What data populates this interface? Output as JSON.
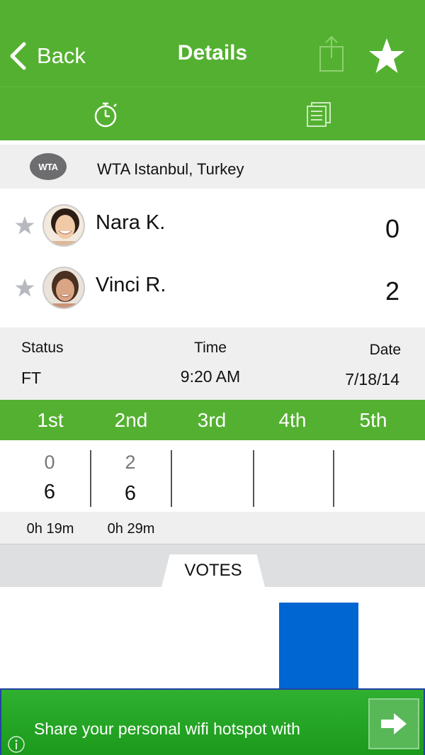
{
  "header": {
    "back_label": "Back",
    "title": "Details",
    "share_icon": "share-icon",
    "favorite_icon": "star-icon"
  },
  "tabs": [
    {
      "icon": "stopwatch-icon"
    },
    {
      "icon": "notes-icon"
    }
  ],
  "tournament": {
    "logo_text": "WTA",
    "name": "WTA Istanbul, Turkey"
  },
  "players": [
    {
      "name": "Nara K.",
      "score": "0"
    },
    {
      "name": "Vinci R.",
      "score": "2"
    }
  ],
  "match_info": {
    "status_label": "Status",
    "status_value": "FT",
    "time_label": "Time",
    "time_value": "9:20 AM",
    "date_label": "Date",
    "date_value": "7/18/14"
  },
  "sets": {
    "labels": [
      "1st",
      "2nd",
      "3rd",
      "4th",
      "5th"
    ],
    "scores": [
      {
        "top": "0",
        "bottom": "6"
      },
      {
        "top": "2",
        "bottom": "6"
      }
    ],
    "durations": [
      "0h 19m",
      "0h 29m"
    ]
  },
  "votes": {
    "tab_label": "VOTES",
    "bar_color": "#0066d1",
    "bar_fraction": 0.85
  },
  "ad": {
    "text": "Share your personal wifi hotspot with",
    "arrow_icon": "arrow-right-icon",
    "info_icon": "info-icon"
  },
  "colors": {
    "brand_green": "#54b031",
    "panel_gray": "#efeff0"
  }
}
